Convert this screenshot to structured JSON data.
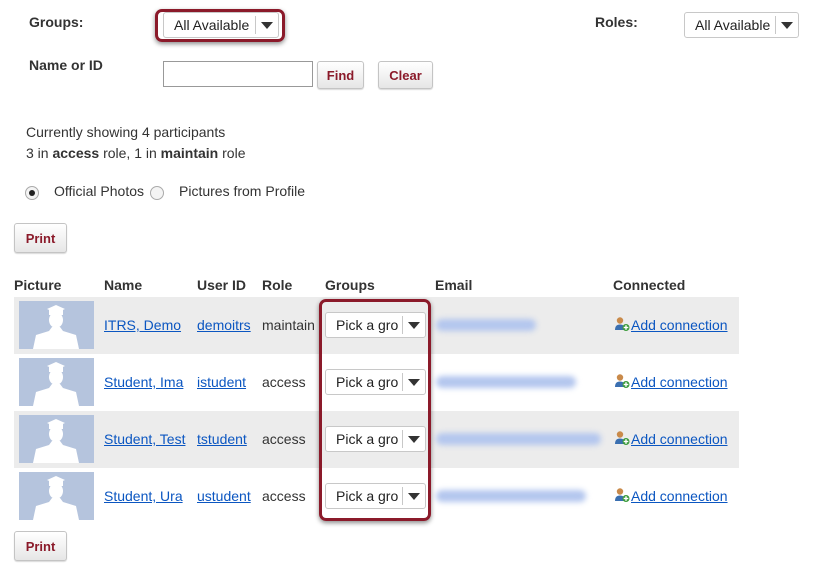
{
  "filters": {
    "groups_label": "Groups:",
    "groups_value": "All Available",
    "roles_label": "Roles:",
    "roles_value": "All Available",
    "name_label": "Name or ID",
    "name_value": "",
    "find_label": "Find",
    "clear_label": "Clear"
  },
  "summary": {
    "line1": "Currently showing 4 participants",
    "line2_pre": "3 in ",
    "line2_role1": "access",
    "line2_mid": " role, 1 in ",
    "line2_role2": "maintain",
    "line2_post": " role"
  },
  "photo_options": {
    "official": "Official Photos",
    "profile": "Pictures from Profile",
    "selected": "official"
  },
  "print_label": "Print",
  "table": {
    "headers": [
      "Picture",
      "Name",
      "User ID",
      "Role",
      "Groups",
      "Email",
      "Connected"
    ],
    "rows": [
      {
        "name": "ITRS, Demo",
        "user_id": "demoitrs",
        "role": "maintain",
        "group": "Pick a gro",
        "connect": "Add connection"
      },
      {
        "name": "Student, Ima",
        "user_id": "istudent",
        "role": "access",
        "group": "Pick a gro",
        "connect": "Add connection"
      },
      {
        "name": "Student, Test",
        "user_id": "tstudent",
        "role": "access",
        "group": "Pick a gro",
        "connect": "Add connection"
      },
      {
        "name": "Student, Ura",
        "user_id": "ustudent",
        "role": "access",
        "group": "Pick a gro",
        "connect": "Add connection"
      }
    ]
  },
  "colors": {
    "accent": "#8b1a2a",
    "link": "#0b56c1",
    "row_alt": "#ececec"
  },
  "icons": {
    "select_arrow": "chevron-down-icon",
    "connection": "add-user-icon",
    "avatar": "graduate-silhouette-icon"
  }
}
